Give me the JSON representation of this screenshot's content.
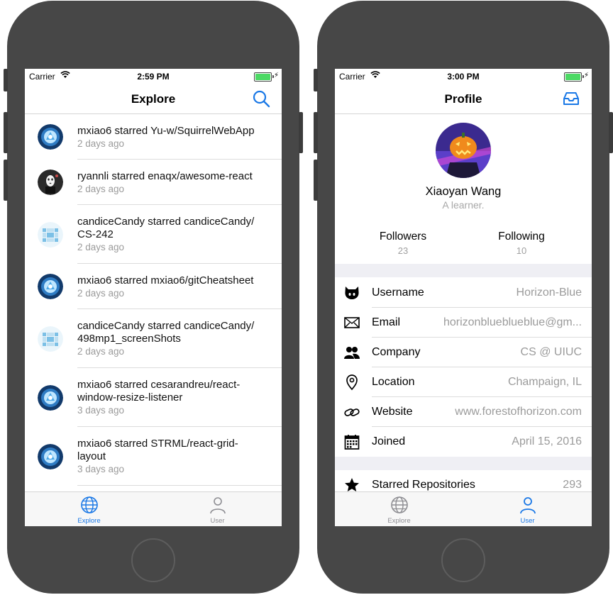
{
  "colors": {
    "accent": "#1a78e6",
    "inactive": "#8e8e93",
    "battery": "#4cd964",
    "phone_body": "#474747"
  },
  "left_phone": {
    "status": {
      "carrier": "Carrier",
      "time": "2:59 PM"
    },
    "nav": {
      "title": "Explore",
      "right_icon": "search-icon"
    },
    "feed": [
      {
        "avatar": "ironman-arc-avatar",
        "text": "mxiao6 starred Yu-w/SquirrelWebApp",
        "time": "2 days ago"
      },
      {
        "avatar": "noface-avatar",
        "text": "ryannli starred enaqx/awesome-react",
        "time": "2 days ago"
      },
      {
        "avatar": "pixel-identicon-avatar",
        "text": "candiceCandy starred candiceCandy/",
        "text2": "CS-242",
        "time": "2 days ago"
      },
      {
        "avatar": "ironman-arc-avatar",
        "text": "mxiao6 starred mxiao6/gitCheatsheet",
        "time": "2 days ago"
      },
      {
        "avatar": "pixel-identicon-avatar",
        "text": "candiceCandy starred candiceCandy/",
        "text2": "498mp1_screenShots",
        "time": "2 days ago"
      },
      {
        "avatar": "ironman-arc-avatar",
        "text": "mxiao6 starred cesarandreu/react-",
        "text2": "window-resize-listener",
        "time": "3 days ago"
      },
      {
        "avatar": "ironman-arc-avatar",
        "text": "mxiao6 starred STRML/react-grid-",
        "text2": "layout",
        "time": "3 days ago"
      }
    ],
    "tabs": [
      {
        "label": "Explore",
        "icon": "globe-icon",
        "active": true
      },
      {
        "label": "User",
        "icon": "user-icon",
        "active": false
      }
    ]
  },
  "right_phone": {
    "status": {
      "carrier": "Carrier",
      "time": "3:00 PM"
    },
    "nav": {
      "title": "Profile",
      "right_icon": "inbox-icon"
    },
    "profile": {
      "name": "Xiaoyan Wang",
      "bio": "A learner.",
      "followers_label": "Followers",
      "followers": "23",
      "following_label": "Following",
      "following": "10"
    },
    "rows": [
      {
        "icon": "github-icon",
        "label": "Username",
        "value": "Horizon-Blue"
      },
      {
        "icon": "mail-icon",
        "label": "Email",
        "value": "horizonblueblueblue@gm..."
      },
      {
        "icon": "people-icon",
        "label": "Company",
        "value": "CS @ UIUC"
      },
      {
        "icon": "location-pin-icon",
        "label": "Location",
        "value": "Champaign, IL"
      },
      {
        "icon": "link-icon",
        "label": "Website",
        "value": "www.forestofhorizon.com"
      },
      {
        "icon": "calendar-icon",
        "label": "Joined",
        "value": "April 15, 2016"
      }
    ],
    "starred": {
      "icon": "star-icon",
      "label": "Starred Repositories",
      "value": "293"
    },
    "tabs": [
      {
        "label": "Explore",
        "icon": "globe-icon",
        "active": false
      },
      {
        "label": "User",
        "icon": "user-icon",
        "active": true
      }
    ]
  }
}
